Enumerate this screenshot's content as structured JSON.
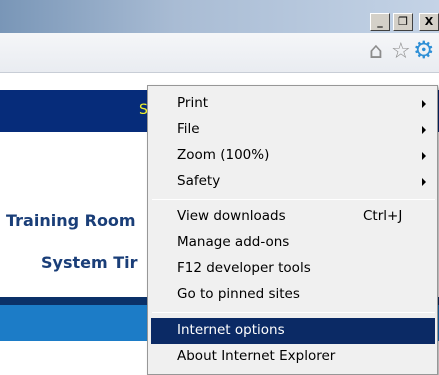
{
  "window_controls": {
    "minimize": "_",
    "maximize": "❐",
    "close": "X"
  },
  "toolbar": {
    "home_icon": "⌂",
    "favorites_icon": "☆",
    "tools_icon": "⚙"
  },
  "page": {
    "nav_text": "S",
    "line1": "Training Room",
    "line2": "System Tir"
  },
  "menu": {
    "items": [
      {
        "label": "Print",
        "has_submenu": true
      },
      {
        "label": "File",
        "has_submenu": true
      },
      {
        "label": "Zoom (100%)",
        "has_submenu": true
      },
      {
        "label": "Safety",
        "has_submenu": true
      },
      {
        "label": "View downloads",
        "shortcut": "Ctrl+J"
      },
      {
        "label": "Manage add-ons"
      },
      {
        "label": "F12 developer tools"
      },
      {
        "label": "Go to pinned sites"
      },
      {
        "label": "Internet options",
        "selected": true
      },
      {
        "label": "About Internet Explorer"
      }
    ]
  }
}
